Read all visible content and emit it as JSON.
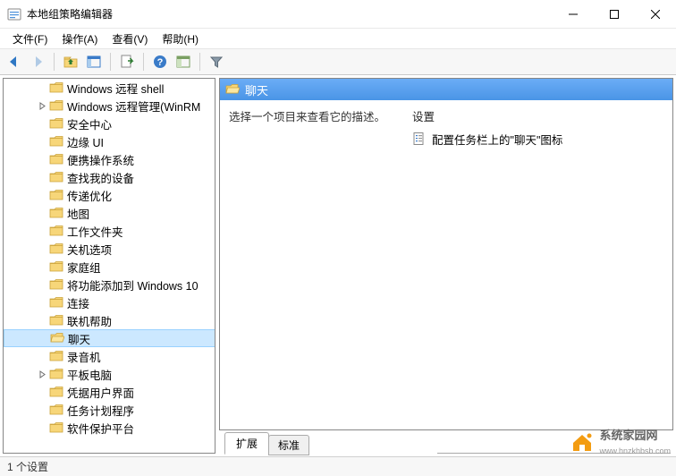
{
  "window": {
    "title": "本地组策略编辑器"
  },
  "menu": {
    "items": [
      {
        "label": "文件(F)"
      },
      {
        "label": "操作(A)"
      },
      {
        "label": "查看(V)"
      },
      {
        "label": "帮助(H)"
      }
    ]
  },
  "toolbar": {
    "items": [
      {
        "name": "back-icon",
        "enabled": true
      },
      {
        "name": "forward-icon",
        "enabled": false
      },
      {
        "name": "sep"
      },
      {
        "name": "up-folder-icon",
        "enabled": true
      },
      {
        "name": "show-hide-tree-icon",
        "enabled": true
      },
      {
        "name": "sep"
      },
      {
        "name": "export-list-icon",
        "enabled": true
      },
      {
        "name": "sep"
      },
      {
        "name": "help-icon",
        "enabled": true
      },
      {
        "name": "extended-view-icon",
        "enabled": true
      },
      {
        "name": "sep"
      },
      {
        "name": "filter-icon",
        "enabled": true
      }
    ]
  },
  "tree": {
    "items": [
      {
        "label": "Windows 远程 shell",
        "indent": 2,
        "expandable": false
      },
      {
        "label": "Windows 远程管理(WinRM",
        "indent": 2,
        "expandable": true
      },
      {
        "label": "安全中心",
        "indent": 2,
        "expandable": false
      },
      {
        "label": "边缘 UI",
        "indent": 2,
        "expandable": false
      },
      {
        "label": "便携操作系统",
        "indent": 2,
        "expandable": false
      },
      {
        "label": "查找我的设备",
        "indent": 2,
        "expandable": false
      },
      {
        "label": "传递优化",
        "indent": 2,
        "expandable": false
      },
      {
        "label": "地图",
        "indent": 2,
        "expandable": false
      },
      {
        "label": "工作文件夹",
        "indent": 2,
        "expandable": false
      },
      {
        "label": "关机选项",
        "indent": 2,
        "expandable": false
      },
      {
        "label": "家庭组",
        "indent": 2,
        "expandable": false
      },
      {
        "label": "将功能添加到 Windows 10",
        "indent": 2,
        "expandable": false
      },
      {
        "label": "连接",
        "indent": 2,
        "expandable": false
      },
      {
        "label": "联机帮助",
        "indent": 2,
        "expandable": false
      },
      {
        "label": "聊天",
        "indent": 2,
        "expandable": false,
        "selected": true,
        "open": true
      },
      {
        "label": "录音机",
        "indent": 2,
        "expandable": false
      },
      {
        "label": "平板电脑",
        "indent": 2,
        "expandable": true
      },
      {
        "label": "凭据用户界面",
        "indent": 2,
        "expandable": false
      },
      {
        "label": "任务计划程序",
        "indent": 2,
        "expandable": false
      },
      {
        "label": "软件保护平台",
        "indent": 2,
        "expandable": false
      }
    ]
  },
  "details": {
    "header": "聊天",
    "description_prompt": "选择一个项目来查看它的描述。",
    "settings_column_header": "设置",
    "settings": [
      {
        "label": "配置任务栏上的\"聊天\"图标"
      }
    ]
  },
  "tabs": {
    "items": [
      {
        "label": "扩展",
        "active": true
      },
      {
        "label": "标准",
        "active": false
      }
    ]
  },
  "statusbar": {
    "text": "1 个设置"
  },
  "watermark": {
    "text": "系统家园网",
    "url": "www.hnzkhbsb.com"
  }
}
